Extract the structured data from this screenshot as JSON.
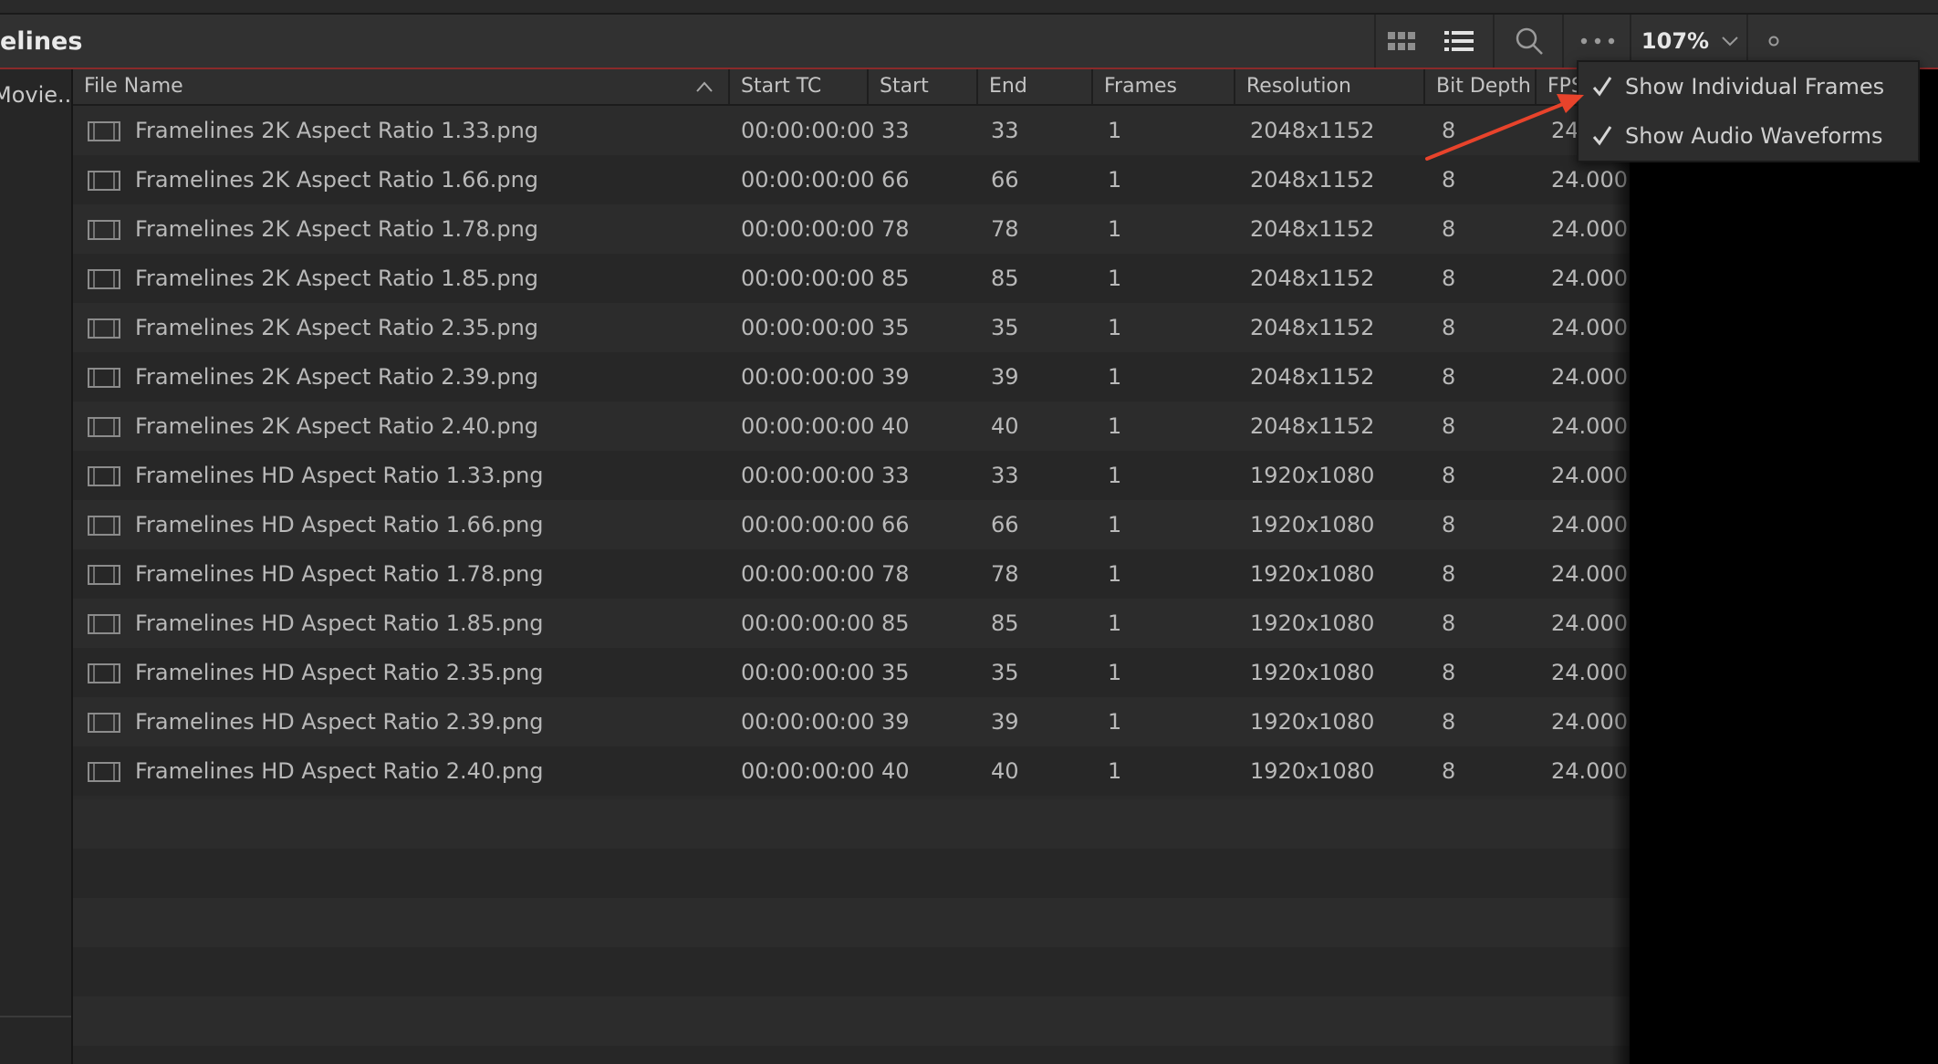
{
  "header": {
    "bin_title": "elines",
    "zoom": "107%",
    "accent_color": "#8a2a2a"
  },
  "sidebar": {
    "item": "Movie..."
  },
  "table": {
    "columns": [
      "File Name",
      "Start TC",
      "Start",
      "End",
      "Frames",
      "Resolution",
      "Bit Depth",
      "FPS"
    ],
    "rows": [
      [
        "Framelines 2K Aspect Ratio 1.33.png",
        "00:00:00:00",
        "33",
        "33",
        "1",
        "2048x1152",
        "8",
        "24.000"
      ],
      [
        "Framelines 2K Aspect Ratio 1.66.png",
        "00:00:00:00",
        "66",
        "66",
        "1",
        "2048x1152",
        "8",
        "24.000"
      ],
      [
        "Framelines 2K Aspect Ratio 1.78.png",
        "00:00:00:00",
        "78",
        "78",
        "1",
        "2048x1152",
        "8",
        "24.000"
      ],
      [
        "Framelines 2K Aspect Ratio 1.85.png",
        "00:00:00:00",
        "85",
        "85",
        "1",
        "2048x1152",
        "8",
        "24.000"
      ],
      [
        "Framelines 2K Aspect Ratio 2.35.png",
        "00:00:00:00",
        "35",
        "35",
        "1",
        "2048x1152",
        "8",
        "24.000"
      ],
      [
        "Framelines 2K Aspect Ratio 2.39.png",
        "00:00:00:00",
        "39",
        "39",
        "1",
        "2048x1152",
        "8",
        "24.000"
      ],
      [
        "Framelines 2K Aspect Ratio 2.40.png",
        "00:00:00:00",
        "40",
        "40",
        "1",
        "2048x1152",
        "8",
        "24.000"
      ],
      [
        "Framelines HD Aspect Ratio 1.33.png",
        "00:00:00:00",
        "33",
        "33",
        "1",
        "1920x1080",
        "8",
        "24.000"
      ],
      [
        "Framelines HD Aspect Ratio 1.66.png",
        "00:00:00:00",
        "66",
        "66",
        "1",
        "1920x1080",
        "8",
        "24.000"
      ],
      [
        "Framelines HD Aspect Ratio 1.78.png",
        "00:00:00:00",
        "78",
        "78",
        "1",
        "1920x1080",
        "8",
        "24.000"
      ],
      [
        "Framelines HD Aspect Ratio 1.85.png",
        "00:00:00:00",
        "85",
        "85",
        "1",
        "1920x1080",
        "8",
        "24.000"
      ],
      [
        "Framelines HD Aspect Ratio 2.35.png",
        "00:00:00:00",
        "35",
        "35",
        "1",
        "1920x1080",
        "8",
        "24.000"
      ],
      [
        "Framelines HD Aspect Ratio 2.39.png",
        "00:00:00:00",
        "39",
        "39",
        "1",
        "1920x1080",
        "8",
        "24.000"
      ],
      [
        "Framelines HD Aspect Ratio 2.40.png",
        "00:00:00:00",
        "40",
        "40",
        "1",
        "1920x1080",
        "8",
        "24.000"
      ]
    ]
  },
  "menu": {
    "items": [
      {
        "label": "Show Individual Frames",
        "checked": true
      },
      {
        "label": "Show Audio Waveforms",
        "checked": true
      }
    ]
  },
  "annotation": {
    "arrow_color": "#e8432b"
  }
}
